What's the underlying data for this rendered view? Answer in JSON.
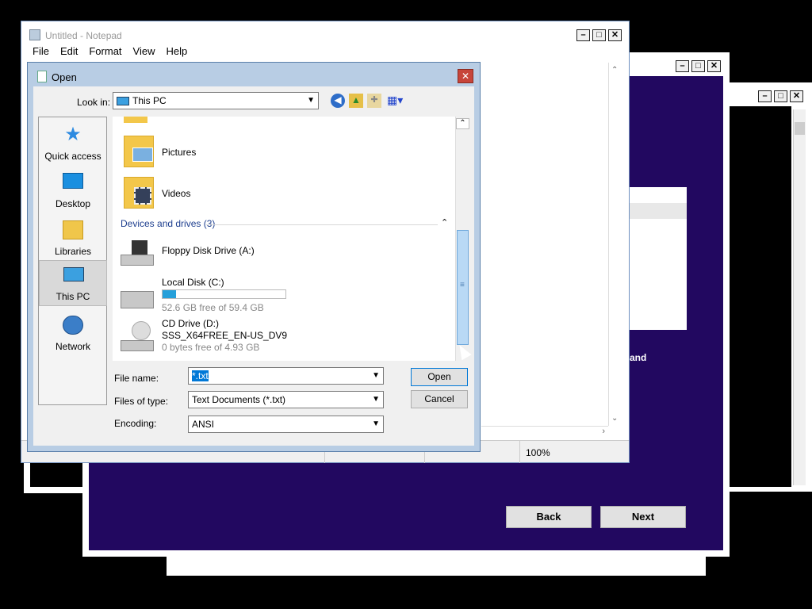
{
  "notepad": {
    "title": "Untitled - Notepad",
    "menus": [
      "File",
      "Edit",
      "Format",
      "View",
      "Help"
    ],
    "zoom": "100%"
  },
  "background_wizard": {
    "partial_text": "and",
    "back_label": "Back",
    "next_label": "Next",
    "color": "#220860"
  },
  "dialog": {
    "title": "Open",
    "look_in_label": "Look in:",
    "look_in_value": "This PC",
    "places": [
      {
        "label": "Quick access",
        "icon": "quick-access-icon"
      },
      {
        "label": "Desktop",
        "icon": "desktop-icon"
      },
      {
        "label": "Libraries",
        "icon": "libraries-icon"
      },
      {
        "label": "This PC",
        "icon": "this-pc-icon"
      },
      {
        "label": "Network",
        "icon": "network-icon"
      }
    ],
    "folders": [
      {
        "name": "Pictures",
        "icon": "pictures-folder-icon"
      },
      {
        "name": "Videos",
        "icon": "videos-folder-icon"
      }
    ],
    "group_header": "Devices and drives (3)",
    "drives": [
      {
        "name": "Floppy Disk Drive (A:)",
        "label": "",
        "free": "",
        "icon": "floppy-drive-icon"
      },
      {
        "name": "Local Disk (C:)",
        "label": "",
        "free": "52.6 GB free of 59.4 GB",
        "used_fraction": 0.11,
        "icon": "hard-drive-icon"
      },
      {
        "name": "CD Drive (D:)",
        "label": "SSS_X64FREE_EN-US_DV9",
        "free": "0 bytes free of 4.93 GB",
        "icon": "cd-drive-icon"
      }
    ],
    "file_name_label": "File name:",
    "file_name_value": "*.txt",
    "files_of_type_label": "Files of type:",
    "files_of_type_value": "Text Documents (*.txt)",
    "encoding_label": "Encoding:",
    "encoding_value": "ANSI",
    "open_label": "Open",
    "cancel_label": "Cancel"
  }
}
